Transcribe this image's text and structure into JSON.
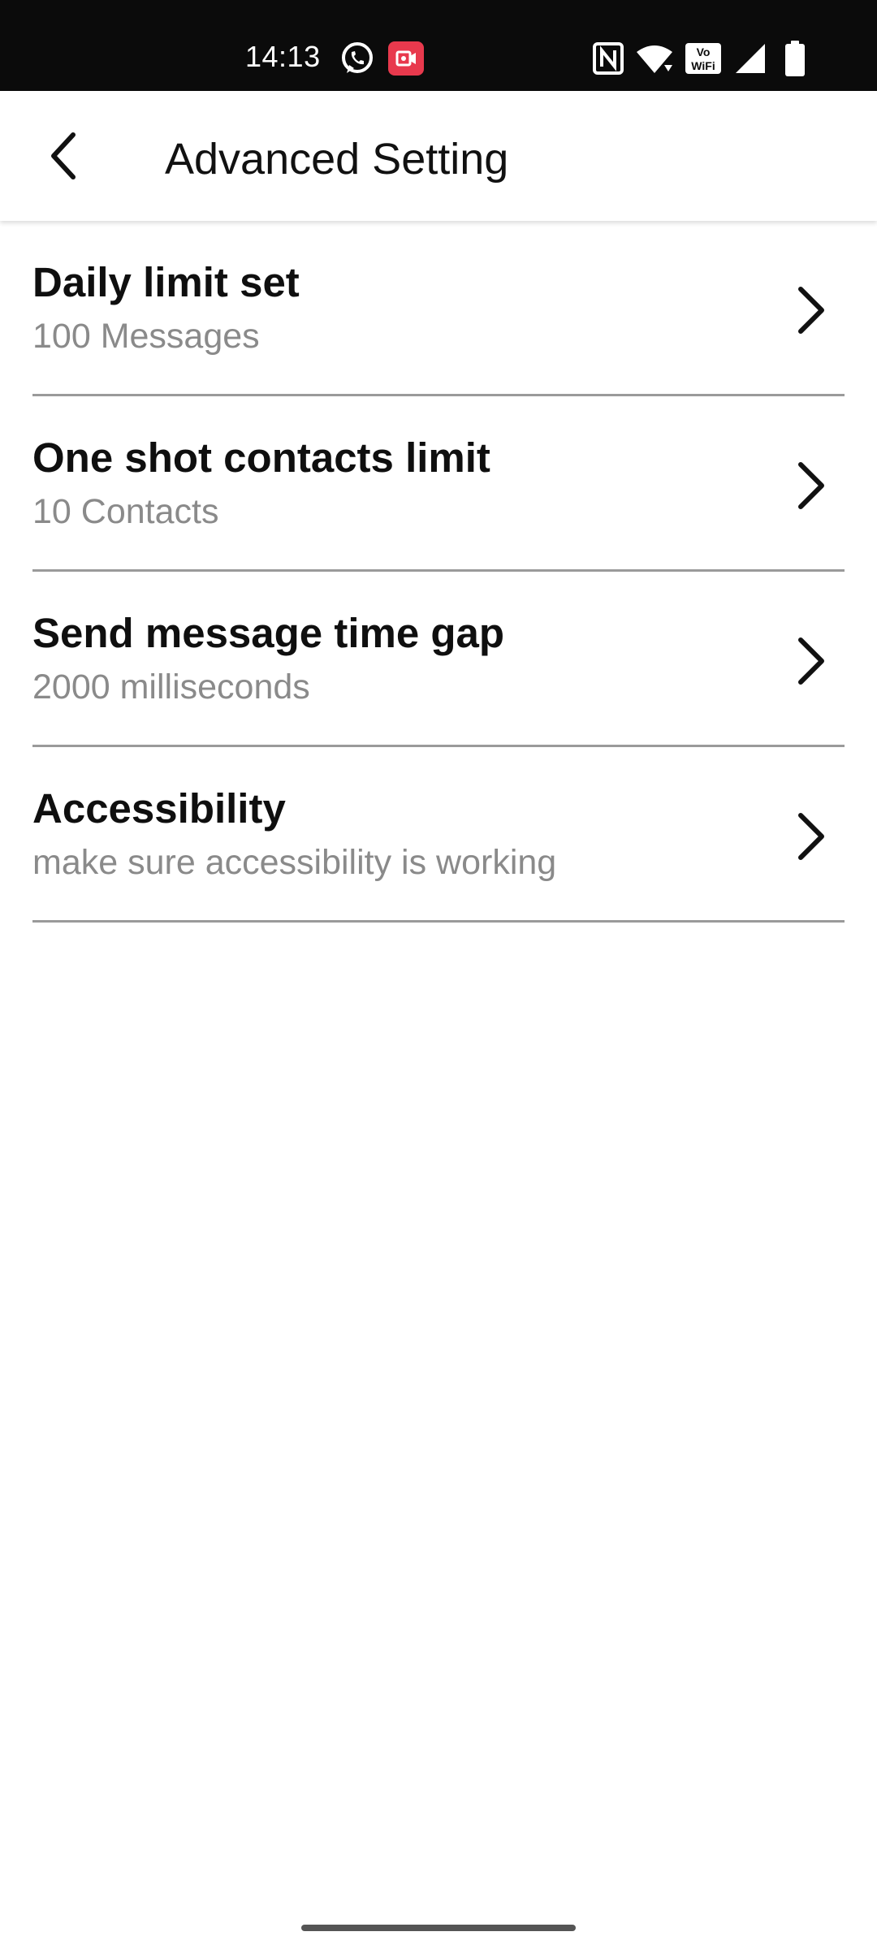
{
  "status_bar": {
    "time": "14:13",
    "icons": [
      "whatsapp-icon",
      "screen-record-icon",
      "nfc-icon",
      "wifi-icon",
      "vowifi-icon",
      "signal-icon",
      "battery-icon"
    ],
    "record_badge_color": "#e8394d",
    "background": "#0b0b0b"
  },
  "app_bar": {
    "title": "Advanced Setting",
    "back_icon": "back-arrow-icon"
  },
  "settings": [
    {
      "title": "Daily limit set",
      "subtitle": "100 Messages"
    },
    {
      "title": "One shot contacts limit",
      "subtitle": "10 Contacts"
    },
    {
      "title": "Send message time gap",
      "subtitle": "2000 milliseconds"
    },
    {
      "title": "Accessibility",
      "subtitle": "make sure accessibility is working"
    }
  ],
  "colors": {
    "title_text": "#0f0f0f",
    "subtitle_text": "#8a8a8a",
    "divider": "#9a9a9a"
  }
}
